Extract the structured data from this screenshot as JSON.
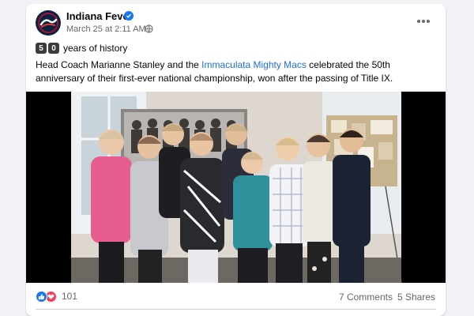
{
  "post": {
    "page_name": "Indiana Fever",
    "timestamp": "March 25 at 2:11 AM",
    "timestamp_separator": "·",
    "headline_digits": [
      "5",
      "0"
    ],
    "headline_text": "years of history",
    "body_before_link": "Head Coach Marianne Stanley and the ",
    "body_link": "Immaculata Mighty Macs",
    "body_after_link": " celebrated the 50th anniversary of their first-ever national championship, won after the passing of Title IX.",
    "reaction_count": "101",
    "comments": "7 Comments",
    "shares": "5 Shares"
  },
  "icons": {
    "verified": "verified-badge-icon",
    "privacy": "globe-icon",
    "more": "more-options-icon",
    "like": "like-reaction-icon",
    "love": "love-reaction-icon"
  },
  "colors": {
    "link": "#216fdb",
    "verified": "#1877f2",
    "like": "#1877f2",
    "love": "#f33e58",
    "secondary_text": "#65676b"
  }
}
